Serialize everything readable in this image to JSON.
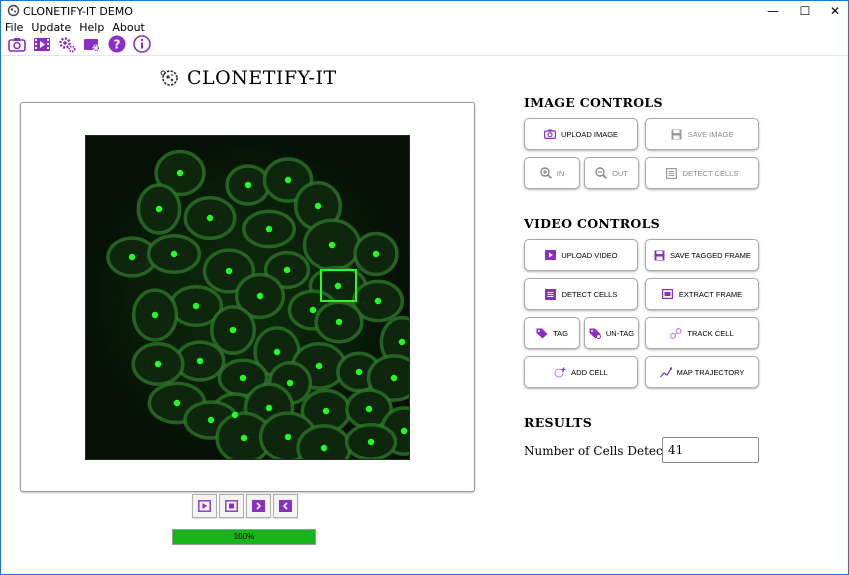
{
  "window": {
    "title": "CLONETIFY-IT DEMO"
  },
  "menu": {
    "items": [
      "File",
      "Update",
      "Help",
      "About"
    ]
  },
  "toolbar": {
    "icons": [
      "camera-icon",
      "video-icon",
      "settings-icon",
      "video-settings-icon",
      "help-icon",
      "info-icon"
    ],
    "accent": "#8a2fc2"
  },
  "app": {
    "title": "CLONETIFY-IT"
  },
  "image_controls": {
    "heading": "IMAGE CONTROLS",
    "upload_image": "UPLOAD IMAGE",
    "save_image": "SAVE IMAGE",
    "zoom_in": "IN",
    "zoom_out": "OUT",
    "detect_cells": "DETECT CELLS"
  },
  "video_controls": {
    "heading": "VIDEO CONTROLS",
    "upload_video": "UPLOAD VIDEO",
    "save_tagged_frame": "SAVE TAGGED FRAME",
    "detect_cells": "DETECT CELLS",
    "extract_frame": "EXTRACT FRAME",
    "tag": "TAG",
    "untag": "UN-TAG",
    "track_cell": "TRACK CELL",
    "add_cell": "ADD CELL",
    "map_trajectory": "MAP TRAJECTORY"
  },
  "results": {
    "heading": "RESULTS",
    "cells_label": "Number of Cells Detected:",
    "cells_value": "41"
  },
  "progress": {
    "value": 1.0,
    "label": "100%"
  },
  "colors": {
    "accent": "#8a2fc2",
    "progress": "#16b31a",
    "marker": "#22ff22"
  }
}
